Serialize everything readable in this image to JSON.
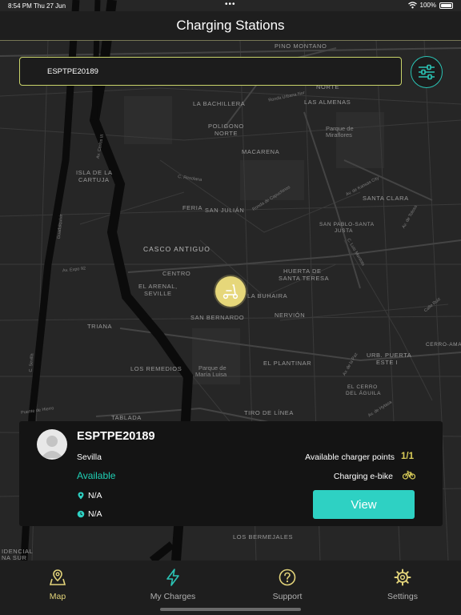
{
  "status_bar": {
    "time": "8:54 PM",
    "date": "Thu 27 Jun",
    "battery": "100%"
  },
  "header": {
    "title": "Charging Stations"
  },
  "search": {
    "value": "ESPTPE20189"
  },
  "map": {
    "labels": {
      "pino_montano": "PINO MONTANO",
      "norte": "NORTE",
      "la_bachillera": "LA BACHILLERA",
      "las_almenas": "LAS ALMENAS",
      "poligono": "POLIGONO",
      "poligono_norte": "NORTE",
      "parque_miraflores": "Parque de",
      "parque_miraflores_2": "Miraflores",
      "macarena": "MACARENA",
      "isla_cartuja": "ISLA DE LA",
      "isla_cartuja_2": "CARTUJA",
      "santa_clara": "SANTA CLARA",
      "feria": "FERIA",
      "san_julian": "SAN JULIÁN",
      "san_pablo": "SAN PABLO-SANTA",
      "san_pablo_2": "JUSTA",
      "casco_antiguo": "CASCO ANTIGUO",
      "centro": "CENTRO",
      "huerta": "HUERTA DE",
      "huerta_2": "SANTA TERESA",
      "el_arenal": "EL ARENAL,",
      "el_arenal_2": "SEVILLE",
      "la_buhaira": "LA BUHAIRA",
      "nervion": "NERVIÓN",
      "triana": "TRIANA",
      "san_bernardo": "SAN BERNARDO",
      "cerro_amate": "CERRO-AMATE",
      "urb_puerta": "URB. PUERTA",
      "urb_puerta_2": "ESTE I",
      "los_remedios": "LOS REMEDIOS",
      "parque_maria_luisa": "Parque de",
      "parque_maria_luisa_2": "María Luisa",
      "el_plantinar": "EL PLANTINAR",
      "el_cerro": "EL CERRO",
      "el_cerro_2": "DEL ÁGUILA",
      "tablada": "TABLADA",
      "tiro_de_linea": "TIRO DE LÍNEA",
      "los_bermejales": "LOS BERMEJALES",
      "residencial": "IDENCIAL",
      "residencial_2": "NA SUR"
    },
    "streets": {
      "ronda_urbana": "Ronda Urbana Nor",
      "av_carlos": "Av. Carlos III",
      "c_resolana": "C. Resolana",
      "ronda_capuchinos": "Ronda de Capuchinos",
      "av_kansas": "Av. de Kansas City",
      "av_expo": "Av. Expo 92",
      "av_tolosa": "Av. de Tolosa",
      "c_luis_montoto": "C. Luis Montoto",
      "calle_ruiz": "Calle Ruiz",
      "av_la_paz": "Av. de la Paz",
      "puente_hierro": "Puente de Hierro",
      "av_hytasa": "Av. de Hytasa",
      "guadalquivir": "Guadalquivir",
      "c_sevilla": "C. Sevilla"
    }
  },
  "station": {
    "id": "ESPTPE20189",
    "city": "Sevilla",
    "status": "Available",
    "location": "N/A",
    "hours": "N/A",
    "available_label": "Available charger points",
    "available_value": "1/1",
    "type_label": "Charging e-bike",
    "view_label": "View"
  },
  "tabs": [
    {
      "label": "Map",
      "icon": "map-pin-icon",
      "active": true
    },
    {
      "label": "My Charges",
      "icon": "lightning-icon",
      "active": false
    },
    {
      "label": "Support",
      "icon": "question-icon",
      "active": false
    },
    {
      "label": "Settings",
      "icon": "gear-icon",
      "active": false
    }
  ],
  "colors": {
    "accent_teal": "#2ed1c3",
    "accent_yellow": "#e3d47a",
    "available_green": "#1fd0b5"
  }
}
